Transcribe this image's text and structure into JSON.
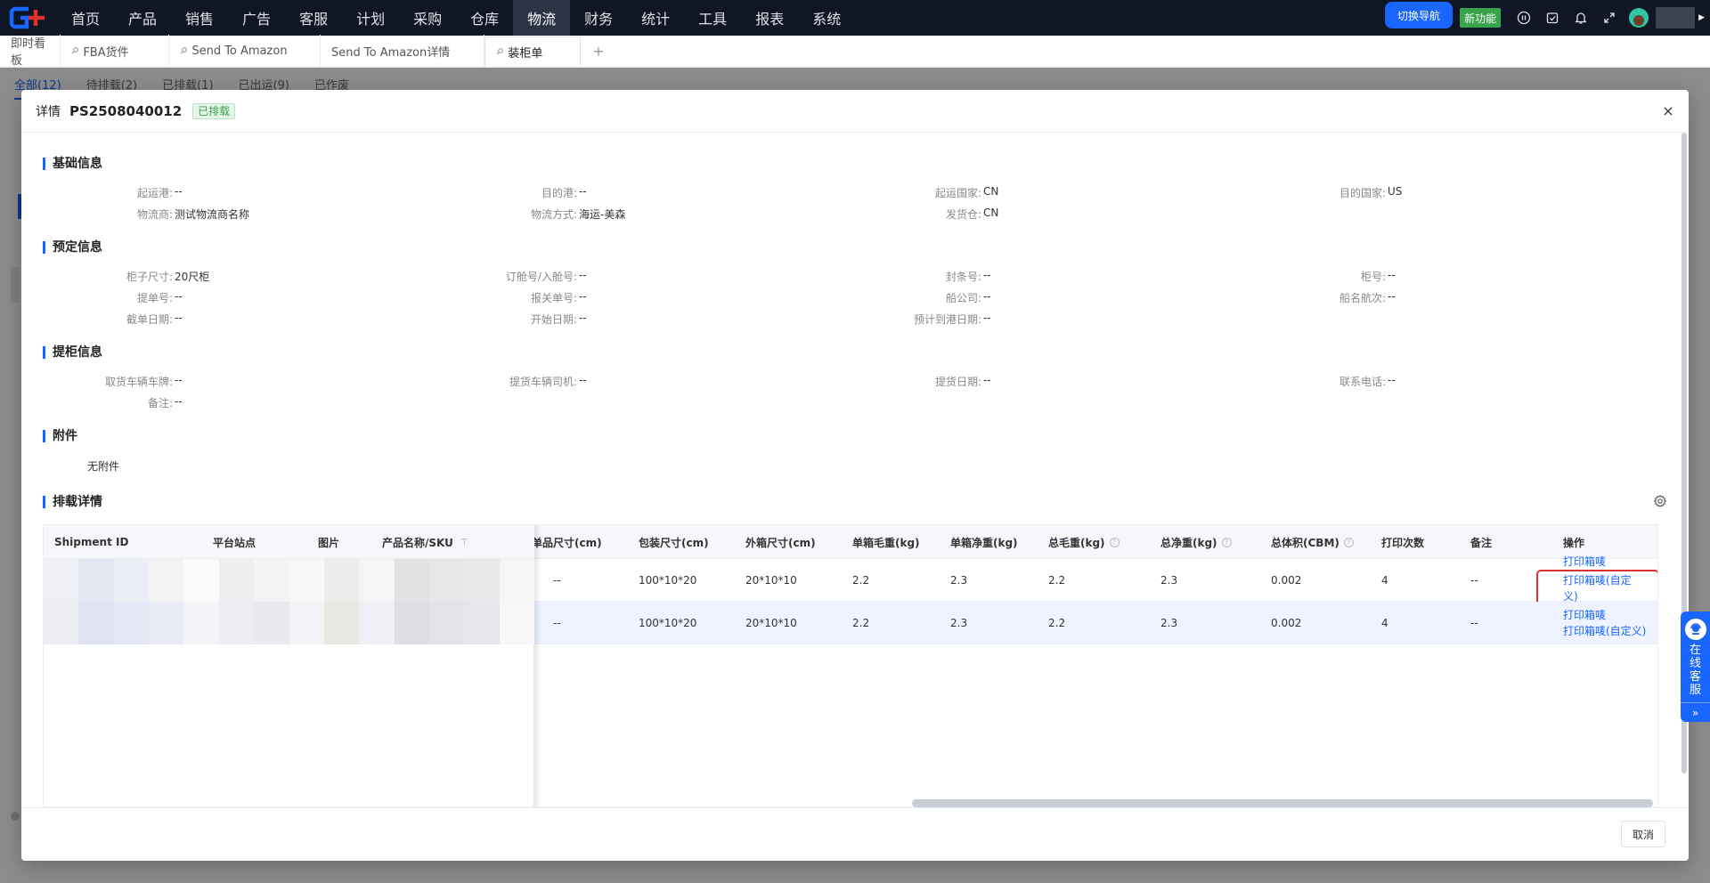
{
  "nav": {
    "items": [
      "首页",
      "产品",
      "销售",
      "广告",
      "客服",
      "计划",
      "采购",
      "仓库",
      "物流",
      "财务",
      "统计",
      "工具",
      "报表",
      "系统"
    ],
    "active_index": 8,
    "switch_nav": "切换导航",
    "new_feature": "新功能"
  },
  "tabs": {
    "items": [
      {
        "label": "即时看板",
        "pinned": false
      },
      {
        "label": "FBA货件",
        "pinned": true
      },
      {
        "label": "Send To Amazon",
        "pinned": true
      },
      {
        "label": "Send To Amazon详情",
        "pinned": false
      },
      {
        "label": "装柜单",
        "pinned": true
      }
    ],
    "active_index": 4,
    "add": "+"
  },
  "subtabs": [
    "全部(12)",
    "待排载(2)",
    "已排载(1)",
    "已出运(9)",
    "已作废"
  ],
  "modal": {
    "title_label": "详情",
    "title_no": "PS2508040012",
    "status": "已排载",
    "close": "×",
    "sections": {
      "basic": "基础信息",
      "booking": "预定信息",
      "pickup": "提柜信息",
      "attachment": "附件",
      "loading": "排载详情"
    },
    "basic": [
      {
        "label": "起运港:",
        "value": "--"
      },
      {
        "label": "目的港:",
        "value": "--"
      },
      {
        "label": "起运国家:",
        "value": "CN"
      },
      {
        "label": "目的国家:",
        "value": "US"
      },
      {
        "label": "物流商:",
        "value": "测试物流商名称"
      },
      {
        "label": "物流方式:",
        "value": "海运-美森"
      },
      {
        "label": "发货仓:",
        "value": "CN"
      }
    ],
    "booking": [
      {
        "label": "柜子尺寸:",
        "value": "20尺柜"
      },
      {
        "label": "订舱号/入舱号:",
        "value": "--"
      },
      {
        "label": "封条号:",
        "value": "--"
      },
      {
        "label": "柜号:",
        "value": "--"
      },
      {
        "label": "提单号:",
        "value": "--"
      },
      {
        "label": "报关单号:",
        "value": "--"
      },
      {
        "label": "船公司:",
        "value": "--"
      },
      {
        "label": "船名航次:",
        "value": "--"
      },
      {
        "label": "截单日期:",
        "value": "--"
      },
      {
        "label": "开始日期:",
        "value": "--"
      },
      {
        "label": "预计到港日期:",
        "value": "--"
      }
    ],
    "pickup": [
      {
        "label": "取货车辆车牌:",
        "value": "--"
      },
      {
        "label": "提货车辆司机:",
        "value": "--"
      },
      {
        "label": "提货日期:",
        "value": "--"
      },
      {
        "label": "联系电话:",
        "value": "--"
      },
      {
        "label": "备注:",
        "value": "--"
      }
    ],
    "attachment_text": "无附件",
    "table": {
      "fixed_columns": [
        "Shipment ID",
        "平台站点",
        "图片",
        "产品名称/SKU"
      ],
      "columns": [
        "单品尺寸(cm)",
        "包装尺寸(cm)",
        "外箱尺寸(cm)",
        "单箱毛重(kg)",
        "单箱净重(kg)",
        "总毛重(kg)",
        "总净重(kg)",
        "总体积(CBM)",
        "打印次数",
        "备注",
        "操作"
      ],
      "rows": [
        [
          "--",
          "100*10*20",
          "20*10*10",
          "2.2",
          "2.3",
          "2.2",
          "2.3",
          "0.002",
          "4",
          "--"
        ],
        [
          "--",
          "100*10*20",
          "20*10*10",
          "2.2",
          "2.3",
          "2.2",
          "2.3",
          "0.002",
          "4",
          "--"
        ]
      ],
      "actions": [
        "打印箱唛",
        "打印箱唛(自定义)"
      ]
    },
    "cancel": "取消"
  },
  "chat": {
    "label": "在线客服",
    "arrow": "»"
  },
  "colors": {
    "primary": "#1966ff",
    "nav_bg": "#101623",
    "success": "#39a14d",
    "highlight_box": "#e03131"
  }
}
